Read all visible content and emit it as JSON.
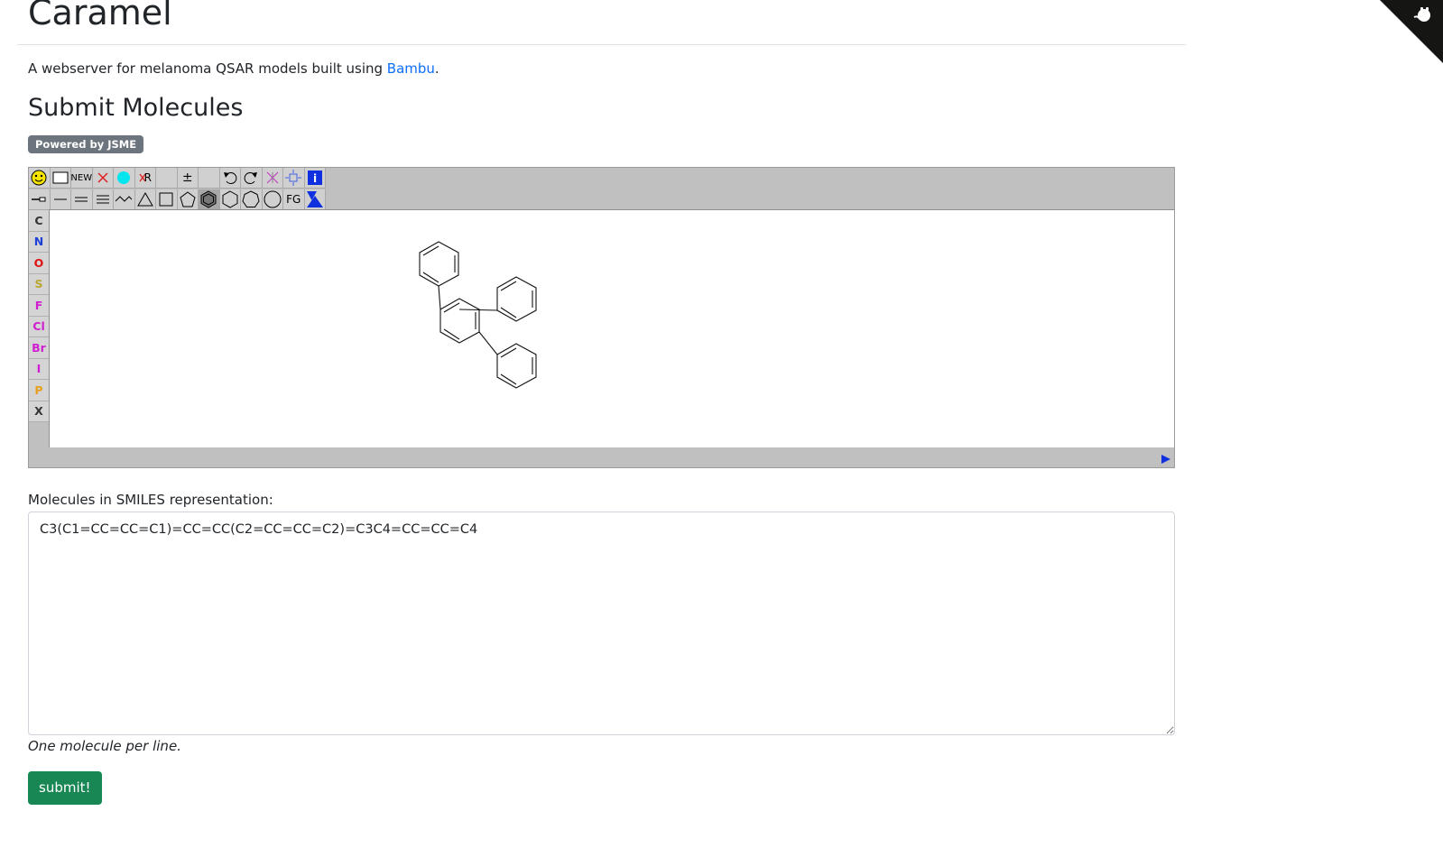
{
  "app": {
    "title": "Caramel",
    "subtitle_prefix": "A webserver for melanoma QSAR models built using ",
    "subtitle_link": "Bambu",
    "subtitle_suffix": "."
  },
  "section": {
    "heading": "Submit Molecules",
    "badge": "Powered by JSME"
  },
  "editor": {
    "toolbar_row1": [
      {
        "name": "smiley-icon",
        "label": ""
      },
      {
        "name": "empty-box-icon",
        "label": ""
      },
      {
        "name": "new-button",
        "label": "NEW"
      },
      {
        "name": "delete-x-icon",
        "label": ""
      },
      {
        "name": "cyan-dot-icon",
        "label": ""
      },
      {
        "name": "delete-r-icon",
        "label": "R"
      },
      {
        "name": "blank-slot",
        "label": ""
      },
      {
        "name": "charge-icon",
        "label": "±"
      },
      {
        "name": "blank-slot-2",
        "label": ""
      },
      {
        "name": "undo-icon",
        "label": ""
      },
      {
        "name": "redo-icon",
        "label": ""
      },
      {
        "name": "clear-icon",
        "label": ""
      },
      {
        "name": "move-icon",
        "label": ""
      },
      {
        "name": "info-icon",
        "label": "i"
      }
    ],
    "toolbar_row2": [
      {
        "name": "chain-icon",
        "label": ""
      },
      {
        "name": "single-bond-icon",
        "label": ""
      },
      {
        "name": "double-bond-icon",
        "label": ""
      },
      {
        "name": "triple-bond-icon",
        "label": ""
      },
      {
        "name": "chain-wave-icon",
        "label": ""
      },
      {
        "name": "triangle-ring-icon",
        "label": ""
      },
      {
        "name": "square-ring-icon",
        "label": ""
      },
      {
        "name": "pentagon-ring-icon",
        "label": ""
      },
      {
        "name": "benzene-ring-icon",
        "label": ""
      },
      {
        "name": "hexagon-ring-icon",
        "label": ""
      },
      {
        "name": "heptagon-ring-icon",
        "label": ""
      },
      {
        "name": "octagon-ring-icon",
        "label": ""
      },
      {
        "name": "functional-group-button",
        "label": "FG"
      },
      {
        "name": "mark-icon",
        "label": ""
      }
    ],
    "elements": [
      {
        "symbol": "C",
        "color": "#333333"
      },
      {
        "symbol": "N",
        "color": "#1f3fd9"
      },
      {
        "symbol": "O",
        "color": "#e01010"
      },
      {
        "symbol": "S",
        "color": "#b8a830"
      },
      {
        "symbol": "F",
        "color": "#d01fd0"
      },
      {
        "symbol": "Cl",
        "color": "#d01fd0"
      },
      {
        "symbol": "Br",
        "color": "#d01fd0"
      },
      {
        "symbol": "I",
        "color": "#d01fd0"
      },
      {
        "symbol": "P",
        "color": "#e8a020"
      },
      {
        "symbol": "X",
        "color": "#333333"
      }
    ]
  },
  "form": {
    "smiles_label": "Molecules in SMILES representation:",
    "smiles_value": "C3(C1=CC=CC=C1)=CC=CC(C2=CC=CC=C2)=C3C4=CC=CC=C4",
    "help_text": "One molecule per line.",
    "submit_label": "submit!"
  }
}
